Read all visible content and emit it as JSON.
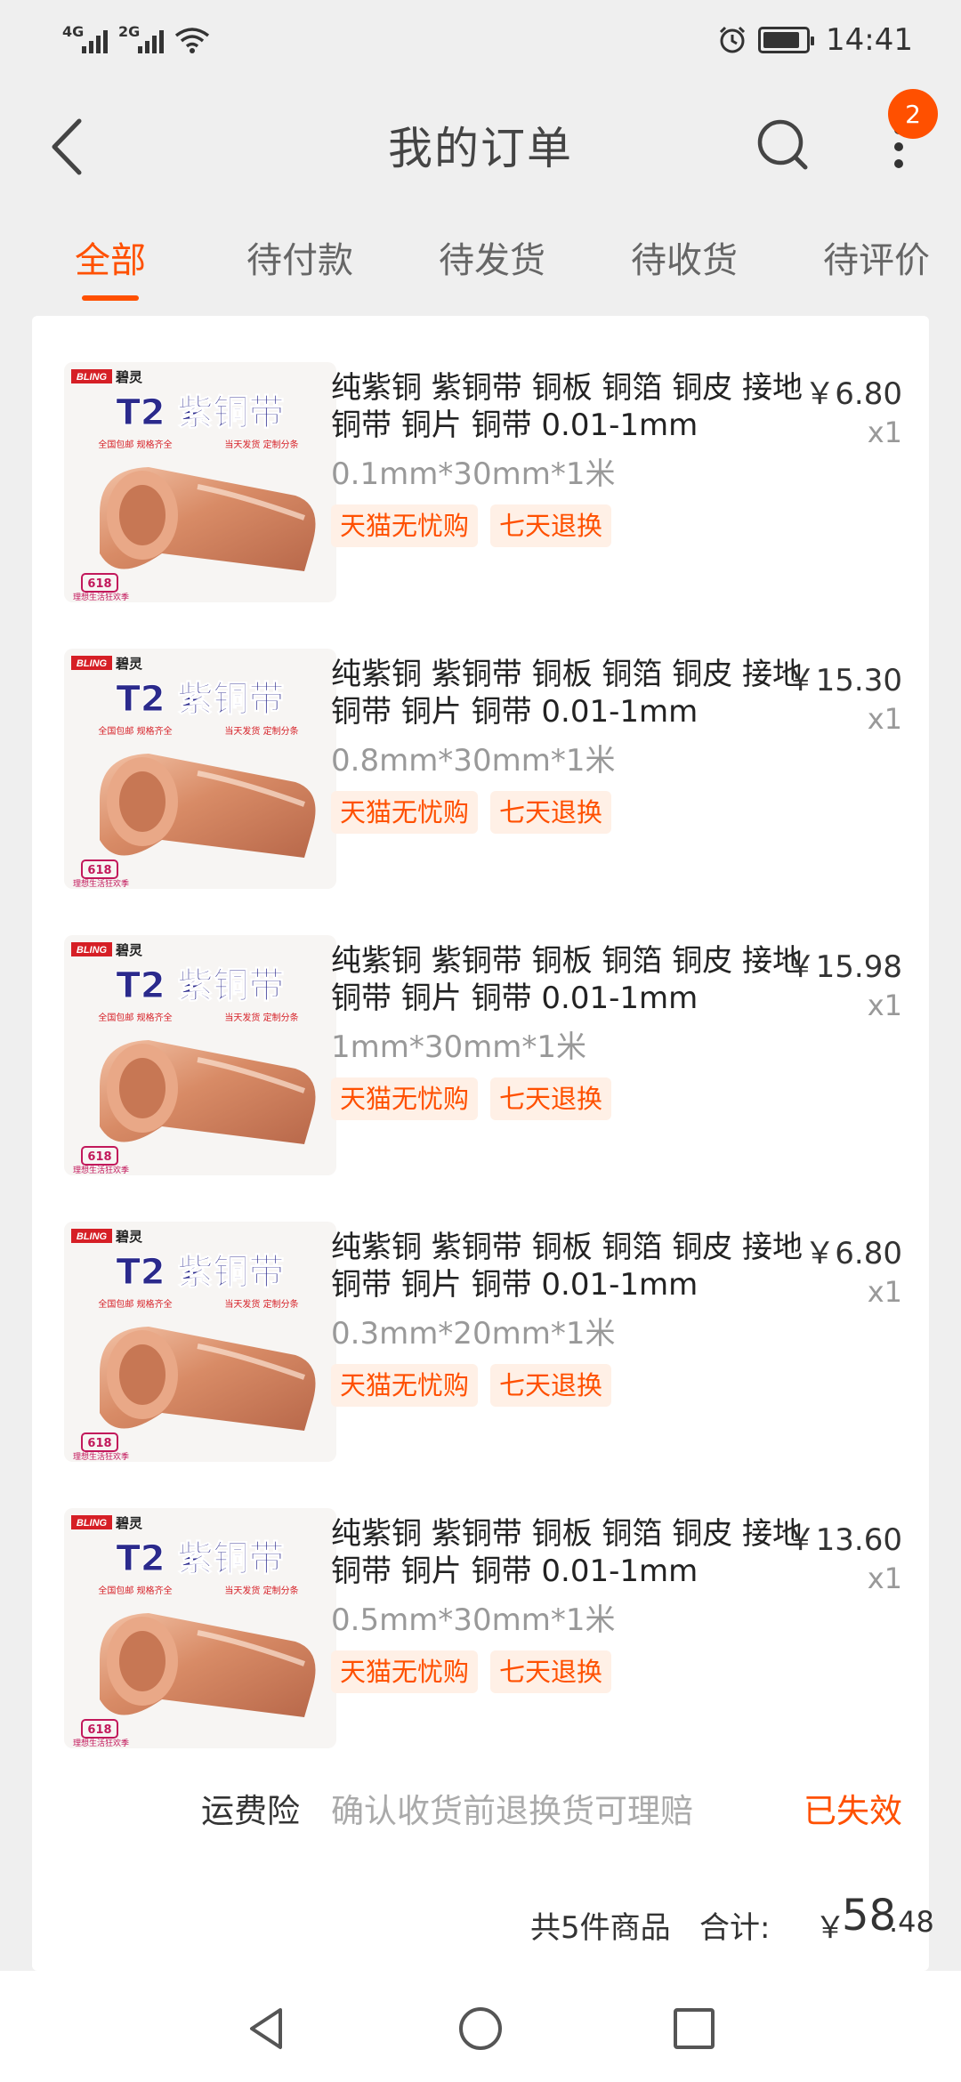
{
  "status_bar": {
    "signal1_label": "4G",
    "signal2_label": "2G",
    "time": "14:41",
    "icons": [
      "signal-4g-icon",
      "signal-2g-icon",
      "wifi-icon",
      "alarm-icon",
      "battery-icon"
    ]
  },
  "header": {
    "title": "我的订单",
    "badge_count": "2",
    "icons": [
      "back-arrow-icon",
      "search-icon",
      "more-vertical-icon"
    ]
  },
  "tabs": [
    {
      "label": "全部",
      "active": true
    },
    {
      "label": "待付款",
      "active": false
    },
    {
      "label": "待发货",
      "active": false
    },
    {
      "label": "待收货",
      "active": false
    },
    {
      "label": "待评价",
      "active": false
    }
  ],
  "order": {
    "items": [
      {
        "title": "纯紫铜 紫铜带 铜板 铜箔 铜皮 接地铜带 铜片 铜带 0.01-1mm",
        "spec": "0.1mm*30mm*1米",
        "price": "￥6.80",
        "qty": "x1",
        "tags": [
          "天猫无忧购",
          "七天退换"
        ]
      },
      {
        "title": "纯紫铜 紫铜带 铜板 铜箔 铜皮 接地铜带 铜片 铜带 0.01-1mm",
        "spec": "0.8mm*30mm*1米",
        "price": "￥15.30",
        "qty": "x1",
        "tags": [
          "天猫无忧购",
          "七天退换"
        ]
      },
      {
        "title": "纯紫铜 紫铜带 铜板 铜箔 铜皮 接地铜带 铜片 铜带 0.01-1mm",
        "spec": "1mm*30mm*1米",
        "price": "￥15.98",
        "qty": "x1",
        "tags": [
          "天猫无忧购",
          "七天退换"
        ]
      },
      {
        "title": "纯紫铜 紫铜带 铜板 铜箔 铜皮 接地铜带 铜片 铜带 0.01-1mm",
        "spec": "0.3mm*20mm*1米",
        "price": "￥6.80",
        "qty": "x1",
        "tags": [
          "天猫无忧购",
          "七天退换"
        ]
      },
      {
        "title": "纯紫铜 紫铜带 铜板 铜箔 铜皮 接地铜带 铜片 铜带 0.01-1mm",
        "spec": "0.5mm*30mm*1米",
        "price": "￥13.60",
        "qty": "x1",
        "tags": [
          "天猫无忧购",
          "七天退换"
        ]
      }
    ],
    "product_image": {
      "brand": "BLING",
      "brand_cn": "碧灵",
      "headline": "T2 紫铜带",
      "sub_left": "全国包邮 规格齐全",
      "sub_right": "当天发货 定制分条",
      "promo": "618",
      "promo_sub": "理想生活狂欢季"
    },
    "shipping_insurance": {
      "label": "运费险",
      "description": "确认收货前退换货可理赔",
      "status": "已失效"
    },
    "summary": {
      "count_text": "共5件商品",
      "total_label": "合计:",
      "currency": "￥",
      "total_int": "58",
      "total_dec": ".48"
    }
  },
  "nav_bar": {
    "icons": [
      "nav-back-icon",
      "nav-home-icon",
      "nav-recents-icon"
    ]
  },
  "colors": {
    "accent": "#ff5000",
    "tag_bg": "#fff0e6",
    "page_bg": "#efefef"
  }
}
